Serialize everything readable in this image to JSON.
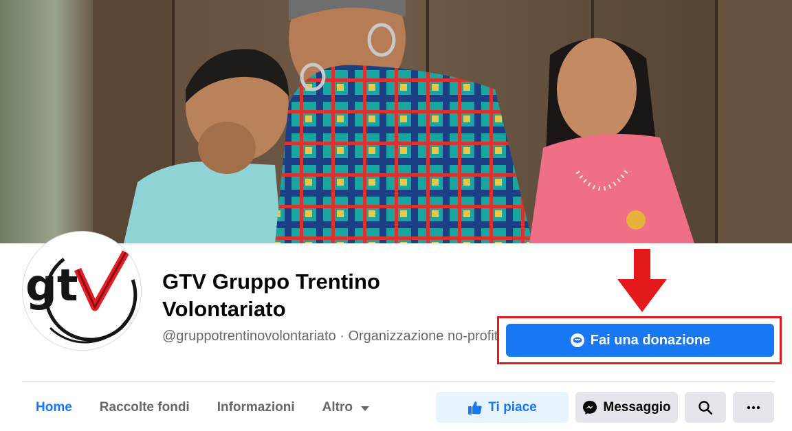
{
  "page": {
    "title": "GTV Gruppo Trentino Volontariato",
    "handle_and_category": "@gruppotrentinovolontariato · Organizzazione no-profit"
  },
  "cover": {
    "description_icon": "cover-photo"
  },
  "avatar": {
    "logo_text": "gtv"
  },
  "donate": {
    "label": "Fai una donazione"
  },
  "tabs": [
    {
      "label": "Home",
      "active": true
    },
    {
      "label": "Raccolte fondi"
    },
    {
      "label": "Informazioni"
    },
    {
      "label": "Altro"
    }
  ],
  "actions": {
    "like_label": "Ti piace",
    "message_label": "Messaggio"
  },
  "colors": {
    "brand_blue": "#1877f2",
    "highlight_red": "#e4191c",
    "secondary_text": "#65676b",
    "button_grey": "#e4e6eb"
  }
}
